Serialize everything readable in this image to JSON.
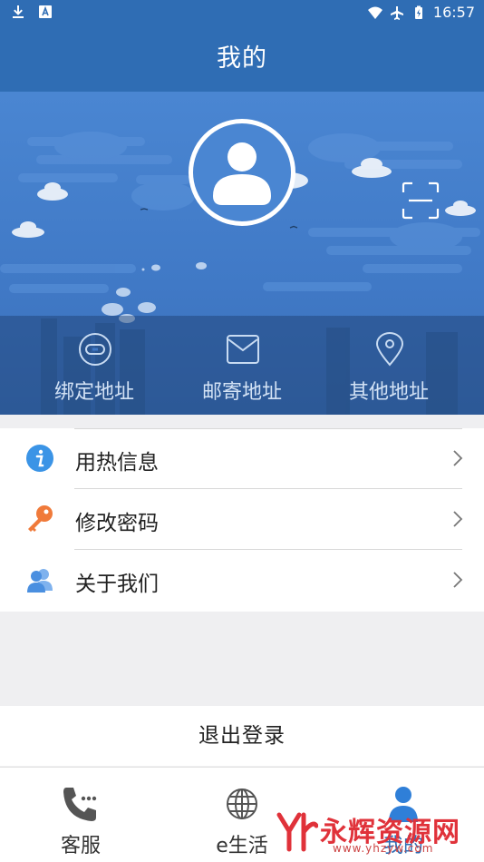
{
  "status_bar": {
    "time": "16:57"
  },
  "header": {
    "title": "我的"
  },
  "addresses": [
    {
      "label": "绑定地址",
      "icon": "link-icon"
    },
    {
      "label": "邮寄地址",
      "icon": "mail-icon"
    },
    {
      "label": "其他地址",
      "icon": "location-pin-icon"
    }
  ],
  "menu": [
    {
      "label": "用热信息",
      "icon": "info-icon"
    },
    {
      "label": "修改密码",
      "icon": "key-icon"
    },
    {
      "label": "关于我们",
      "icon": "users-icon"
    }
  ],
  "logout_label": "退出登录",
  "tabs": [
    {
      "label": "客服",
      "icon": "phone-icon",
      "active": false
    },
    {
      "label": "e生活",
      "icon": "globe-icon",
      "active": false
    },
    {
      "label": "我的",
      "icon": "person-icon",
      "active": true
    }
  ],
  "watermark": {
    "text": "永辉资源网",
    "url": "www.yhzyw.com"
  },
  "colors": {
    "primary": "#2f6db4",
    "hero": "#4a86d2",
    "info": "#3b94e6",
    "key": "#f07a3a",
    "users": "#4a8fe0",
    "watermark": "#e0323a"
  }
}
